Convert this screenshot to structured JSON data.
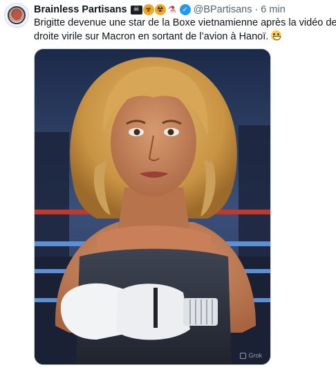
{
  "tweet": {
    "display_name": "Brainless Partisans",
    "name_emojis": [
      "skull-crossbones-emoji",
      "biohazard-emoji",
      "radioactive-emoji",
      "test-tube-emoji"
    ],
    "handle": "@BPartisans",
    "separator": "·",
    "time": "6 min",
    "text_line1": "Brigitte devenue une star de la Boxe vietnamienne après la vidéo de la",
    "text_line2": "droite virile sur Macron en sortant de l’avion à  Hanoï.",
    "text_emoji": "grinning-face-emoji",
    "verified_icon": "verified-badge-icon",
    "verified_color": "#1d9bf0"
  },
  "media": {
    "kind": "image",
    "watermark": "Grok"
  }
}
